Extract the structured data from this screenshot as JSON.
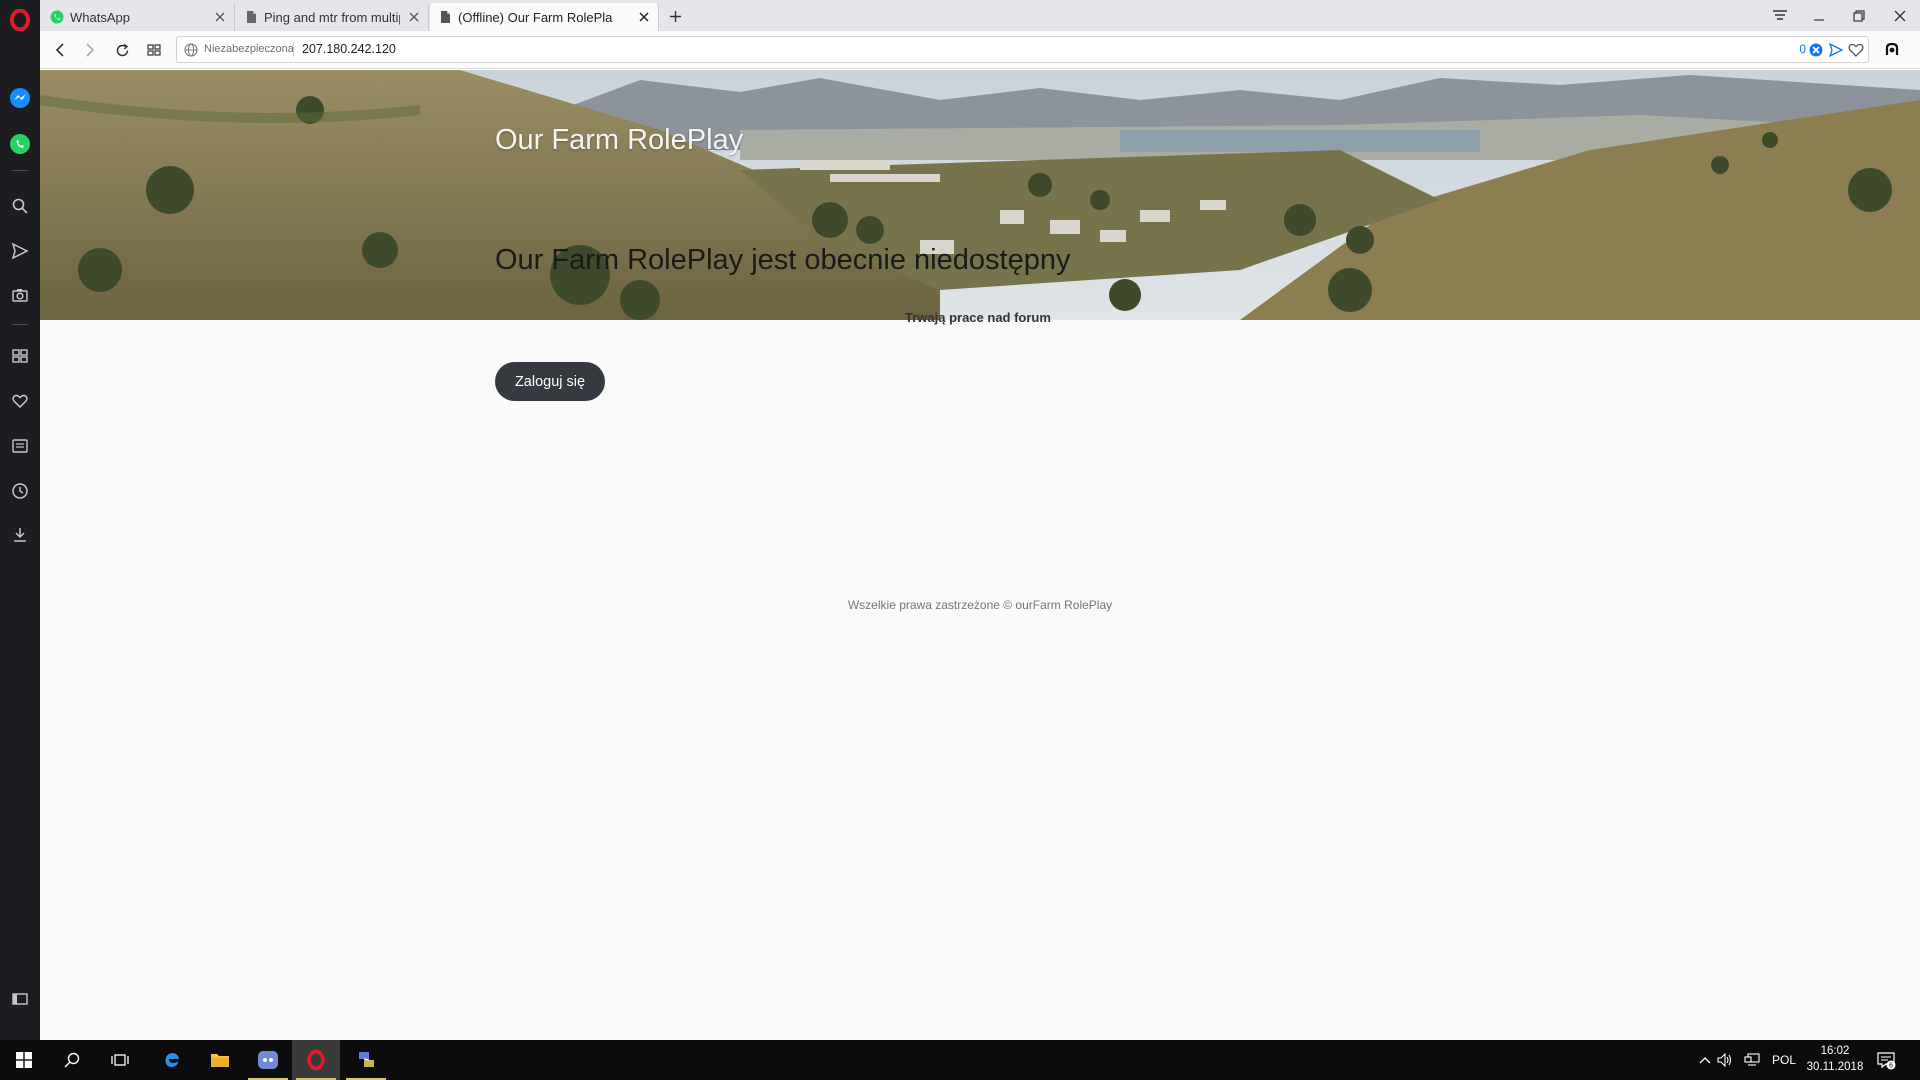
{
  "browser": {
    "tabs": [
      {
        "label": "WhatsApp",
        "icon": "whatsapp-icon",
        "active": false
      },
      {
        "label": "Ping and mtr from multip",
        "icon": "document-icon",
        "active": false
      },
      {
        "label": "(Offline) Our Farm RolePla",
        "icon": "document-icon",
        "active": true
      }
    ],
    "security_label": "Niezabezpieczona",
    "url": "207.180.242.120",
    "ad_block_count": "0"
  },
  "page": {
    "site_title": "Our Farm RolePlay",
    "offline_message": "Our Farm RolePlay jest obecnie niedostępny",
    "sub_message": "Trwają prace nad forum",
    "login_label": "Zaloguj się",
    "footer": "Wszelkie prawa zastrzeżone © ourFarm RolePlay"
  },
  "taskbar": {
    "language": "POL",
    "time": "16:02",
    "date": "30.11.2018",
    "notification_count": "6"
  },
  "colors": {
    "sidebar_bg": "#1c1d20",
    "tabstrip_bg": "#e4e6ea",
    "login_button_bg": "#353a40",
    "opera_red": "#e01c2b",
    "taskbar_bg": "#0c0c0c"
  }
}
